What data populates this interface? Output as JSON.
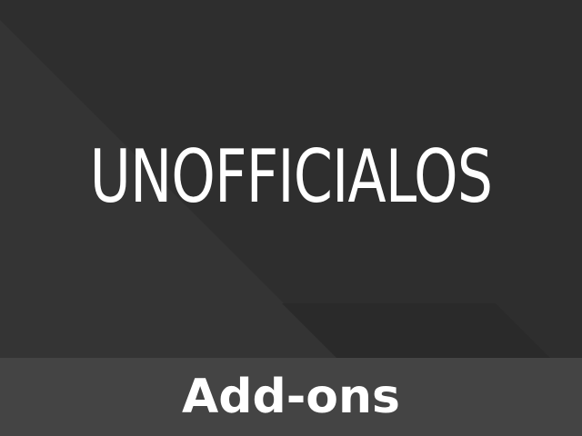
{
  "tile": {
    "logo_text": "UNOFFICIALOS",
    "label": "Add-ons"
  },
  "colors": {
    "background": "#2e2e2e",
    "background_shade": "#343434",
    "label_bar": "#444444",
    "text": "#ffffff"
  }
}
